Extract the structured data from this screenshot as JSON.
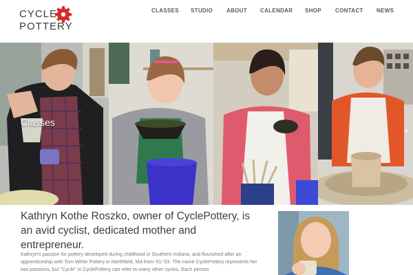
{
  "logo": {
    "line1": "CYCLE",
    "line2": "POTTERY"
  },
  "nav": [
    {
      "label": "CLASSES"
    },
    {
      "label": "STUDIO"
    },
    {
      "label": "ABOUT"
    },
    {
      "label": "CALENDAR"
    },
    {
      "label": "SHOP"
    },
    {
      "label": "CONTACT"
    },
    {
      "label": "NEWS"
    }
  ],
  "slider": {
    "caption": "Classes"
  },
  "colors": {
    "accent": "#d62b2b",
    "heading": "#3d3d3d",
    "body_text": "#777777",
    "nav_text": "#5a5a5a"
  },
  "icons": {
    "logo_mark": "gear-icon",
    "next": "chevron-right-icon"
  },
  "about": {
    "heading": "Kathryn Kothe Roszko, owner of CyclePottery, is an avid cyclist, dedicated mother and entrepreneur.",
    "body": "Kathryn's passion for pottery developed during childhood in Southern Indiana, and flourished after an apprenticeship with Tom White Pottery in Northfield, MA from '01-'03. The name CyclePottery represents her two passions, but \"Cycle\" in CyclePottery can refer to many other cycles. Each person"
  }
}
